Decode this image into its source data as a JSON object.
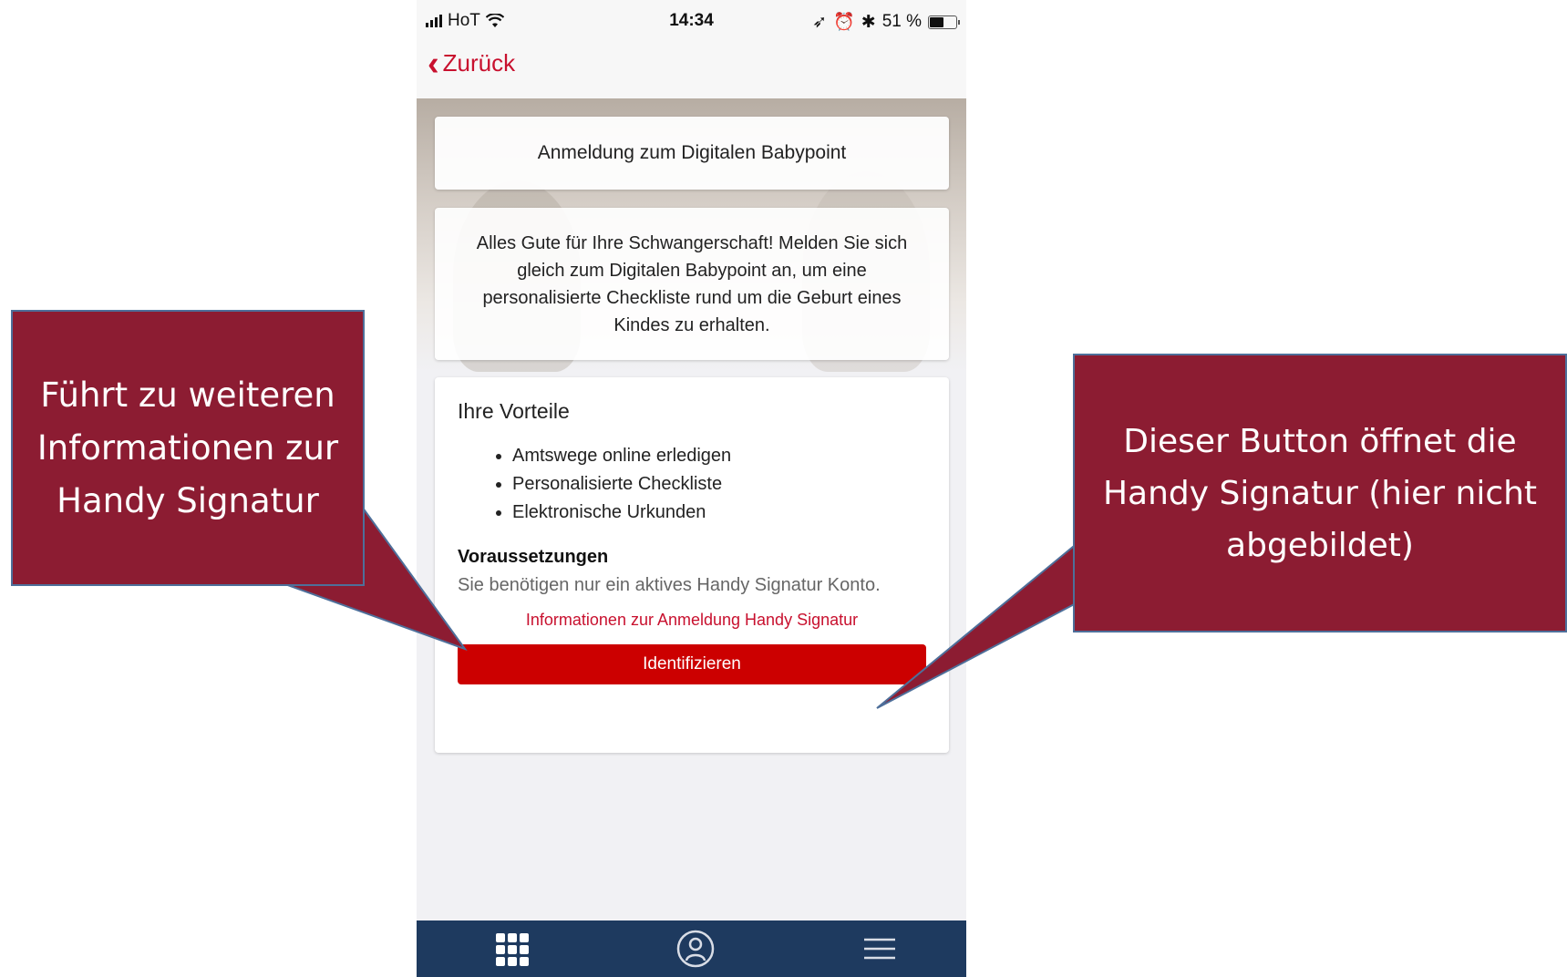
{
  "statusbar": {
    "carrier": "HoT",
    "time": "14:34",
    "battery": "51 %"
  },
  "navbar": {
    "back_label": "Zurück"
  },
  "title_card": {
    "text": "Anmeldung zum Digitalen Babypoint"
  },
  "intro_card": {
    "text": "Alles Gute für Ihre Schwangerschaft! Melden Sie sich gleich zum Digitalen Babypoint an, um eine personalisierte Checkliste rund um die Geburt eines Kindes zu erhalten."
  },
  "main_card": {
    "vorteile_heading": "Ihre Vorteile",
    "vorteile": [
      "Amtswege online erledigen",
      "Personalisierte Checkliste",
      "Elektronische Urkunden"
    ],
    "voraussetzungen_heading": "Voraussetzungen",
    "voraussetzungen_text": "Sie benötigen nur ein aktives Handy Signatur Konto.",
    "info_link": "Informationen zur Anmeldung Handy Signatur",
    "identify_button": "Identifizieren"
  },
  "callouts": {
    "left": "Führt zu weiteren Informationen zur Handy Signatur",
    "right": "Dieser Button öffnet die Handy Signatur (hier nicht abgebildet)"
  },
  "colors": {
    "accent_red": "#c8102e",
    "button_red": "#cc0000",
    "tabbar_navy": "#1e3a5f",
    "callout_maroon": "#8c1c32"
  },
  "icons": {
    "tab_1": "grid-icon",
    "tab_2": "profile-icon",
    "tab_3": "menu-icon"
  }
}
